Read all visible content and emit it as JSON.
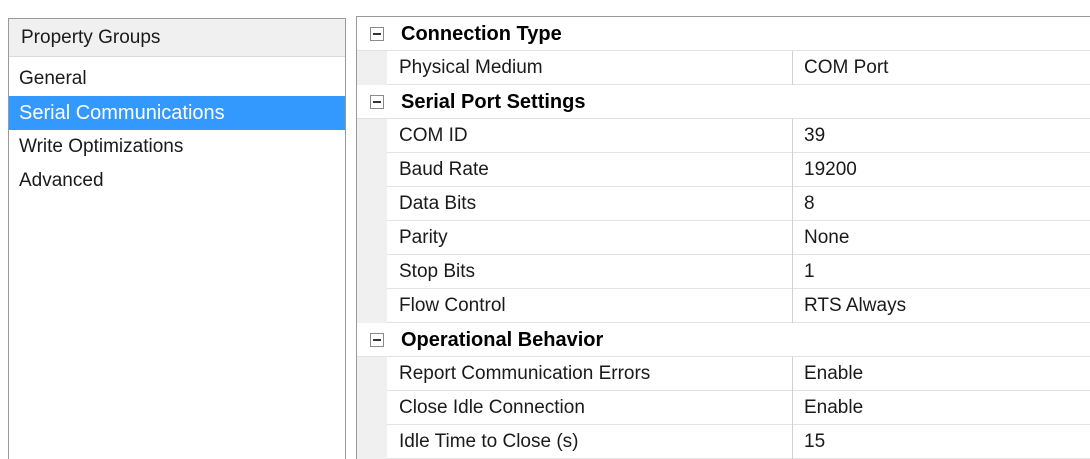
{
  "groups": {
    "header": "Property Groups",
    "items": [
      {
        "label": "General",
        "selected": false
      },
      {
        "label": "Serial Communications",
        "selected": true
      },
      {
        "label": "Write Optimizations",
        "selected": false
      },
      {
        "label": "Advanced",
        "selected": false
      }
    ]
  },
  "grid": {
    "categories": [
      {
        "title": "Connection Type",
        "expanded": true,
        "properties": [
          {
            "name": "Physical Medium",
            "value": "COM Port"
          }
        ]
      },
      {
        "title": "Serial Port Settings",
        "expanded": true,
        "properties": [
          {
            "name": "COM ID",
            "value": "39"
          },
          {
            "name": "Baud Rate",
            "value": "19200"
          },
          {
            "name": "Data Bits",
            "value": "8"
          },
          {
            "name": "Parity",
            "value": "None"
          },
          {
            "name": "Stop Bits",
            "value": "1"
          },
          {
            "name": "Flow Control",
            "value": "RTS Always"
          }
        ]
      },
      {
        "title": "Operational Behavior",
        "expanded": true,
        "properties": [
          {
            "name": "Report Communication Errors",
            "value": "Enable"
          },
          {
            "name": "Close Idle Connection",
            "value": "Enable"
          },
          {
            "name": "Idle Time to Close (s)",
            "value": "15"
          }
        ]
      }
    ]
  },
  "colors": {
    "selection": "#3399ff",
    "gutter": "#f0f0f0",
    "header_bg": "#f0f0f0"
  },
  "icons": {
    "collapse_toggle": "minus-box-icon"
  }
}
